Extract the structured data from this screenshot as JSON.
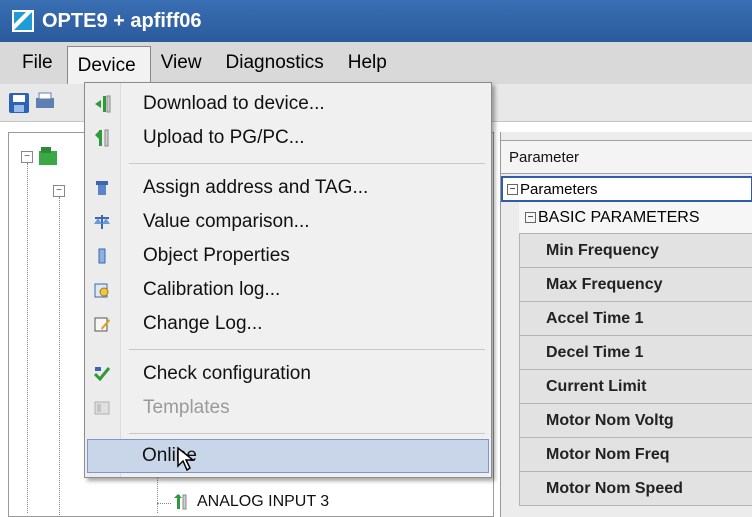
{
  "window": {
    "title": "OPTE9 + apfiff06"
  },
  "menubar": {
    "items": [
      {
        "label": "File"
      },
      {
        "label": "Device"
      },
      {
        "label": "View"
      },
      {
        "label": "Diagnostics"
      },
      {
        "label": "Help"
      }
    ]
  },
  "device_menu": {
    "items": [
      {
        "label": "Download to device...",
        "icon": "download-icon"
      },
      {
        "label": "Upload to PG/PC...",
        "icon": "upload-icon"
      },
      {
        "label": "Assign address and TAG...",
        "icon": "assign-address-icon"
      },
      {
        "label": "Value comparison...",
        "icon": "value-comparison-icon"
      },
      {
        "label": "Object Properties",
        "icon": "object-properties-icon"
      },
      {
        "label": "Calibration log...",
        "icon": "calibration-log-icon"
      },
      {
        "label": "Change Log...",
        "icon": "change-log-icon"
      },
      {
        "label": "Check configuration",
        "icon": "check-configuration-icon"
      },
      {
        "label": "Templates",
        "icon": "templates-icon",
        "disabled": true
      },
      {
        "label": "Online",
        "icon": "",
        "highlighted": true
      }
    ]
  },
  "tree": {
    "visible_node": "ANALOG INPUT 3"
  },
  "parameters": {
    "header": "Parameter",
    "group": "Parameters",
    "subgroup": "BASIC PARAMETERS",
    "rows": [
      "Min Frequency",
      "Max Frequency",
      "Accel Time 1",
      "Decel Time 1",
      "Current Limit",
      "Motor Nom Voltg",
      "Motor Nom Freq",
      "Motor Nom Speed"
    ]
  },
  "colors": {
    "titlebar": "#2f62a8",
    "highlight": "#c9d6ea",
    "selection_border": "#2f5cab"
  }
}
